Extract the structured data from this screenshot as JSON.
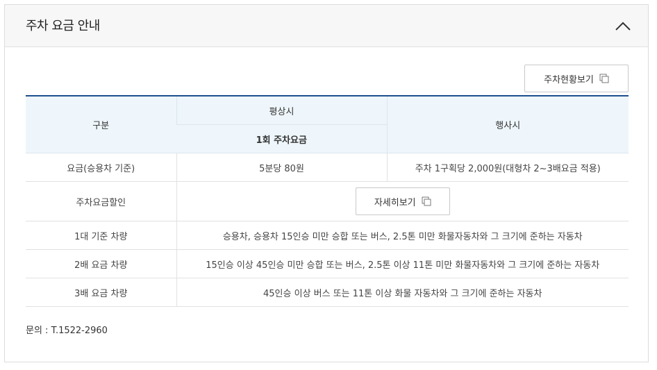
{
  "panel": {
    "title": "주차 요금 안내",
    "toggle_icon": "chevron-up-icon"
  },
  "status_button": {
    "label": "주차현황보기",
    "icon": "copy-icon"
  },
  "table": {
    "header": {
      "col1": "구분",
      "normal": "평상시",
      "normal_sub": "1회 주차요금",
      "event": "행사시"
    },
    "rows": [
      {
        "label": "요금(승용차 기준)",
        "normal": "5분당 80원",
        "event": "주차 1구획당 2,000원(대형차 2~3배요금 적용)"
      },
      {
        "label": "주차요금할인",
        "button": "자세히보기"
      },
      {
        "label": "1대 기준 차량",
        "value": "승용차, 승용차 15인승 미만 승합 또는 버스, 2.5톤 미만 화물자동차와 그 크기에 준하는 자동차"
      },
      {
        "label": "2배 요금 차량",
        "value": "15인승 이상 45인승 미만 승합 또는 버스, 2.5톤 이상 11톤 미만 화물자동차와 그 크기에 준하는 자동차"
      },
      {
        "label": "3배 요금 차량",
        "value": "45인승 이상 버스 또는 11톤 이상 화물 자동차와 그 크기에 준하는 자동차"
      }
    ]
  },
  "contact": "문의 : T.1522-2960",
  "colors": {
    "header_border": "#1f4e8c",
    "header_bg": "#eef6fb",
    "panel_header_bg": "#f7f7f7"
  }
}
